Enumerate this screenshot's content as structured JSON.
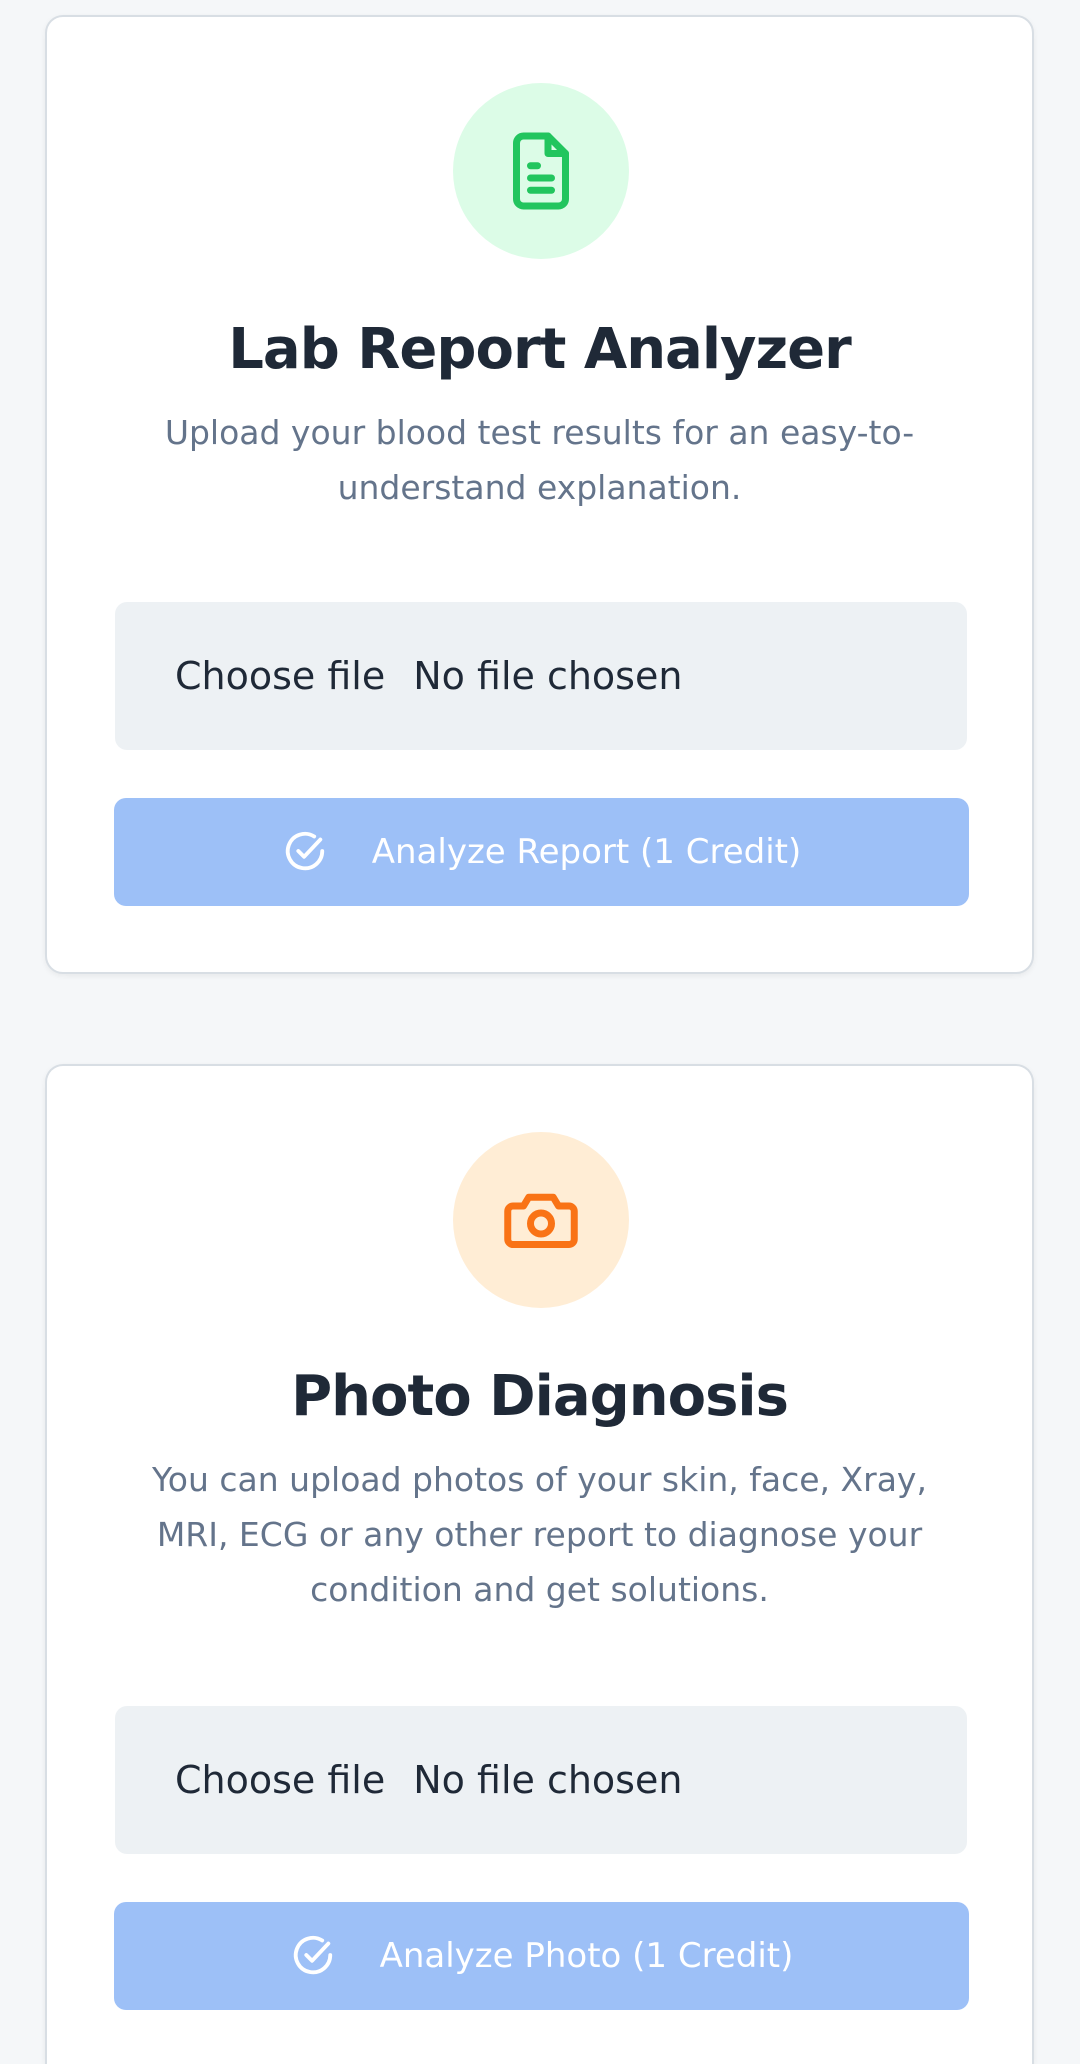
{
  "lab_card": {
    "icon": "document-icon",
    "title": "Lab Report Analyzer",
    "description": "Upload your blood test results for an easy-to-understand explanation.",
    "file_button": "Choose file",
    "file_status": "No file chosen",
    "submit_label": "Analyze Report (1 Credit)",
    "accent_color": "#22c55e",
    "icon_bg": "#dcfce7"
  },
  "photo_card": {
    "icon": "camera-icon",
    "title": "Photo Diagnosis",
    "description": "You can upload photos of your skin, face, Xray, MRI, ECG or any other report to diagnose your condition and get solutions.",
    "file_button": "Choose file",
    "file_status": "No file chosen",
    "submit_label": "Analyze Photo (1 Credit)",
    "accent_color": "#f97316",
    "icon_bg": "#ffedd5"
  },
  "button_color": "#9dc0f7"
}
